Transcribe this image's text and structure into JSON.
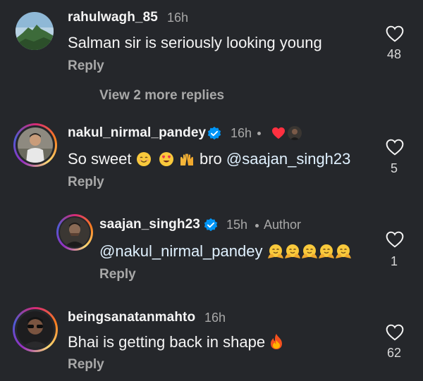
{
  "comments": [
    {
      "username": "rahulwagh_85",
      "time": "16h",
      "text": "Salman sir is seriously looking young",
      "reply": "Reply",
      "likes": "48",
      "view_more": "View 2 more replies"
    },
    {
      "username": "nakul_nirmal_pandey",
      "time": "16h",
      "text_prefix": "So sweet",
      "text_mid": "bro",
      "mention": "@saajan_singh23",
      "reply": "Reply",
      "likes": "5",
      "liked_by_author": true
    },
    {
      "username": "saajan_singh23",
      "time": "15h",
      "author_tag": "Author",
      "mention": "@nakul_nirmal_pandey",
      "reply": "Reply",
      "likes": "1",
      "emoji_count": 5
    },
    {
      "username": "beingsanatanmahto",
      "time": "16h",
      "text": "Bhai is getting back in shape",
      "reply": "Reply",
      "likes": "62"
    }
  ],
  "colors": {
    "background": "#25272b",
    "verified": "#0095f6",
    "mention": "#e0f1ff",
    "heart_red": "#ff3040"
  },
  "icons": [
    "heart-outline-icon",
    "verified-badge-icon",
    "red-heart-icon",
    "fire-emoji",
    "hug-emoji",
    "smile-emoji",
    "heart-eyes-emoji",
    "raised-hands-emoji"
  ]
}
